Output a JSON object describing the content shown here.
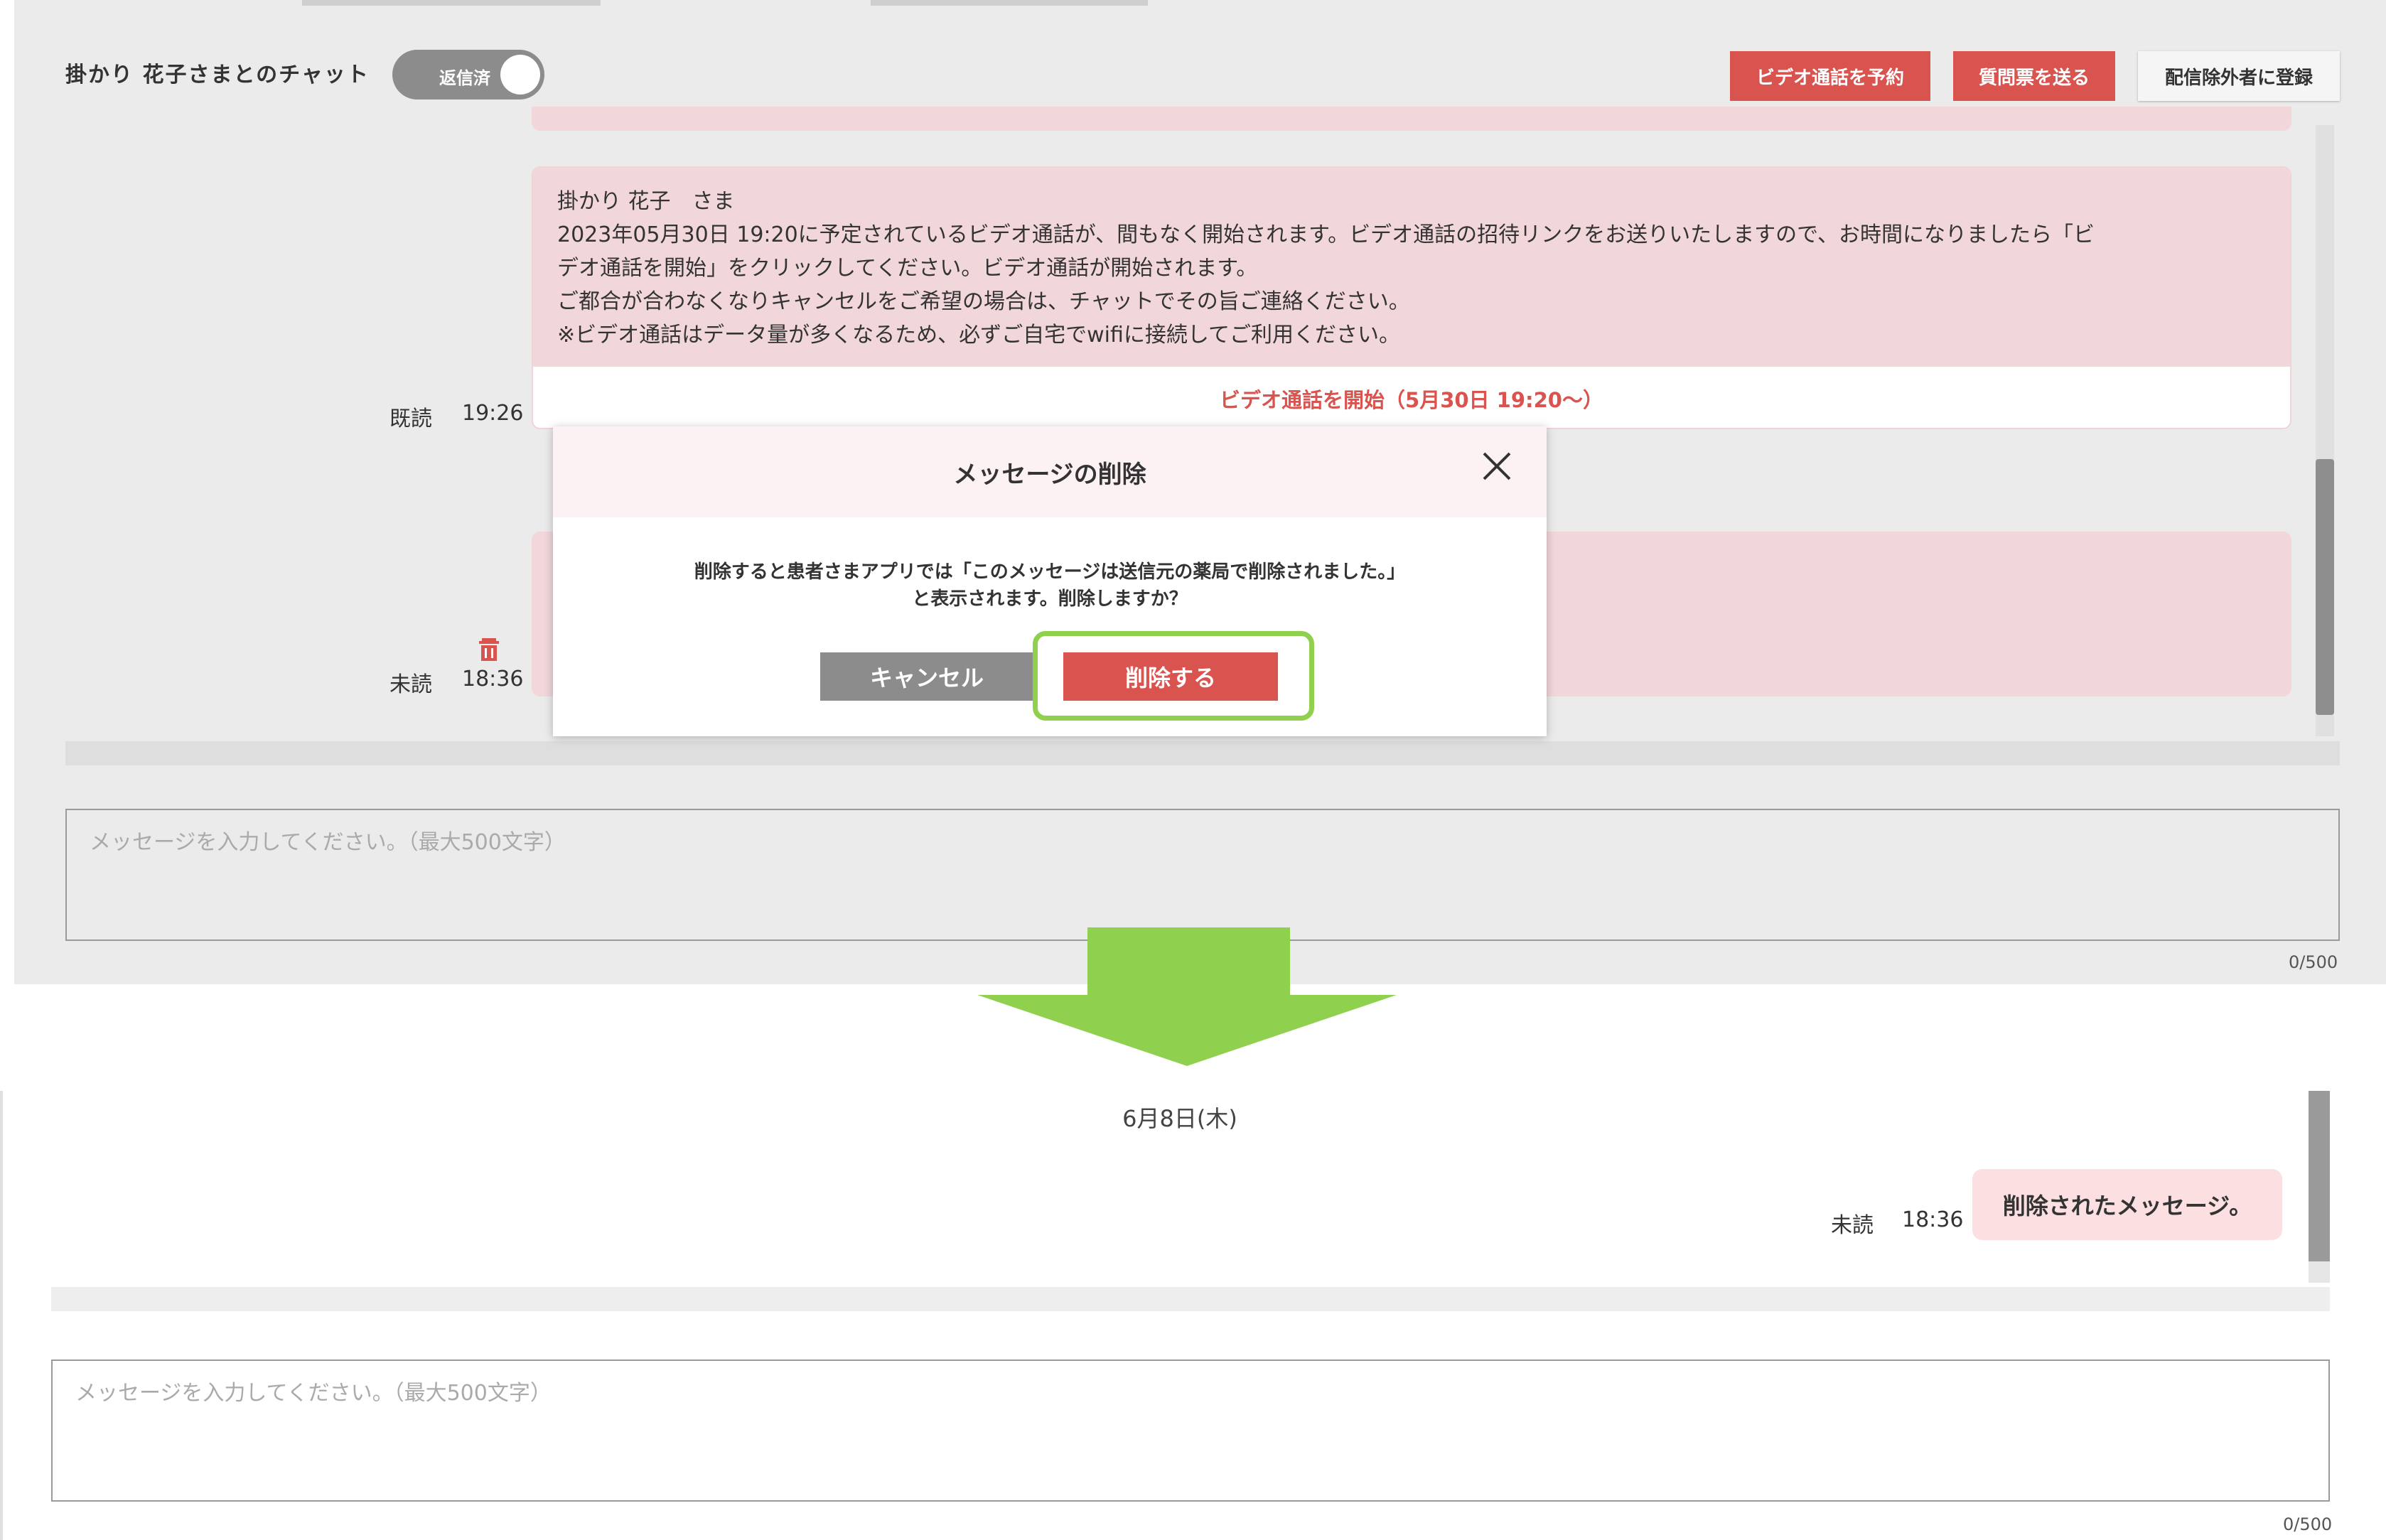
{
  "top_panel": {
    "chat_title": "掛かり 花子さまとのチャット",
    "toggle_label": "返信済",
    "buttons": {
      "schedule_video": "ビデオ通話を予約",
      "send_questionnaire": "質問票を送る",
      "register_exclusion": "配信除外者に登録"
    },
    "message1": {
      "line1": "掛かり 花子　さま",
      "line2": "2023年05月30日 19:20に予定されているビデオ通話が、間もなく開始されます。ビデオ通話の招待リンクをお送りいたしますので、お時間になりましたら「ビ",
      "line3": "デオ通話を開始」をクリックしてください。ビデオ通話が開始されます。",
      "line4": "ご都合が合わなくなりキャンセルをご希望の場合は、チャットでその旨ご連絡ください。",
      "line5": "※ビデオ通話はデータ量が多くなるため、必ずご自宅でwifiに接続してご利用ください。",
      "link": "ビデオ通話を開始（5月30日 19:20～）",
      "status": "既読",
      "time": "19:26"
    },
    "message2": {
      "status": "未読",
      "time": "18:36"
    },
    "input_placeholder": "メッセージを入力してください。（最大500文字）",
    "counter": "0/500"
  },
  "modal": {
    "title": "メッセージの削除",
    "text_line1": "削除すると患者さまアプリでは「このメッセージは送信元の薬局で削除されました。」",
    "text_line2": "と表示されます。削除しますか？",
    "cancel_label": "キャンセル",
    "delete_label": "削除する"
  },
  "bottom_panel": {
    "date": "6月8日(木)",
    "status": "未読",
    "time": "18:36",
    "deleted_message": "削除されたメッセージ。",
    "input_placeholder": "メッセージを入力してください。（最大500文字）",
    "counter": "0/500"
  },
  "colors": {
    "accent_red": "#d9534f",
    "highlight_green": "#8fd14f",
    "bubble_pink": "#f2d7da",
    "toggle_gray": "#8c8c8c"
  },
  "icons": [
    "close-icon",
    "trash-icon",
    "down-arrow-icon"
  ]
}
